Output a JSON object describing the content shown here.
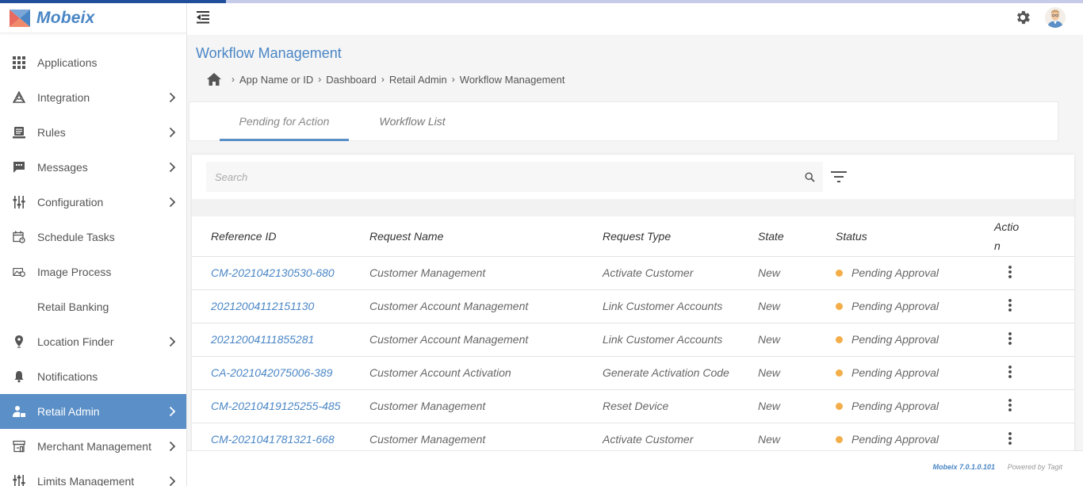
{
  "brand": {
    "name": "Mobeix"
  },
  "sidebar": {
    "items": [
      {
        "label": "Applications",
        "icon": "grid-icon",
        "has_children": false,
        "active": false
      },
      {
        "label": "Integration",
        "icon": "integration-icon",
        "has_children": true,
        "active": false
      },
      {
        "label": "Rules",
        "icon": "rules-icon",
        "has_children": true,
        "active": false
      },
      {
        "label": "Messages",
        "icon": "message-icon",
        "has_children": true,
        "active": false
      },
      {
        "label": "Configuration",
        "icon": "sliders-icon",
        "has_children": true,
        "active": false
      },
      {
        "label": "Schedule Tasks",
        "icon": "calendar-icon",
        "has_children": false,
        "active": false
      },
      {
        "label": "Image Process",
        "icon": "image-icon",
        "has_children": false,
        "active": false
      },
      {
        "label": "Retail Banking",
        "icon": "",
        "has_children": false,
        "active": false
      },
      {
        "label": "Location Finder",
        "icon": "location-pin-icon",
        "has_children": true,
        "active": false
      },
      {
        "label": "Notifications",
        "icon": "bell-icon",
        "has_children": false,
        "active": false
      },
      {
        "label": "Retail Admin",
        "icon": "admin-user-icon",
        "has_children": true,
        "active": true
      },
      {
        "label": "Merchant Management",
        "icon": "store-icon",
        "has_children": true,
        "active": false
      },
      {
        "label": "Limits Management",
        "icon": "limits-icon",
        "has_children": true,
        "active": false
      }
    ]
  },
  "header": {
    "collapse_icon": "menu-collapse-icon",
    "settings_icon": "gear-icon",
    "avatar_icon": "user-avatar"
  },
  "page": {
    "title": "Workflow Management",
    "breadcrumb": [
      "App Name or ID",
      "Dashboard",
      "Retail Admin",
      "Workflow Management"
    ]
  },
  "tabs": [
    {
      "label": "Pending for Action",
      "active": true
    },
    {
      "label": "Workflow List",
      "active": false
    }
  ],
  "search": {
    "placeholder": "Search",
    "value": ""
  },
  "table": {
    "headers": [
      "Reference ID",
      "Request Name",
      "Request Type",
      "State",
      "Status",
      "Actio\nn"
    ],
    "rows": [
      {
        "ref": "CM-2021042130530-680",
        "name": "Customer Management",
        "type": "Activate Customer",
        "state": "New",
        "status": "Pending Approval"
      },
      {
        "ref": "20212004112151130",
        "name": "Customer Account Management",
        "type": "Link Customer Accounts",
        "state": "New",
        "status": "Pending Approval"
      },
      {
        "ref": "20212004111855281",
        "name": "Customer Account Management",
        "type": "Link Customer Accounts",
        "state": "New",
        "status": "Pending Approval"
      },
      {
        "ref": "CA-2021042075006-389",
        "name": "Customer Account Activation",
        "type": "Generate Activation Code",
        "state": "New",
        "status": "Pending Approval"
      },
      {
        "ref": "CM-20210419125255-485",
        "name": "Customer Management",
        "type": "Reset Device",
        "state": "New",
        "status": "Pending Approval"
      },
      {
        "ref": "CM-2021041781321-668",
        "name": "Customer Management",
        "type": "Activate Customer",
        "state": "New",
        "status": "Pending Approval"
      }
    ],
    "status_color": "#f3ae4a"
  },
  "footer": {
    "version": "Mobeix 7.0.1.0.101",
    "powered": "Powered by Tagit"
  },
  "colors": {
    "accent": "#4a86c5",
    "active_menu": "#5b8fc7",
    "top_bar": "#1f4f9b"
  }
}
